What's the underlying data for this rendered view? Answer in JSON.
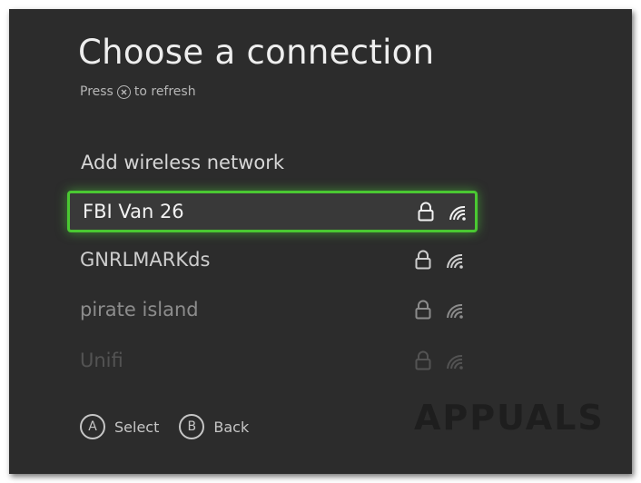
{
  "screen": {
    "title": "Choose a connection",
    "hint_prefix": "Press",
    "hint_button": "X",
    "hint_suffix": "to refresh",
    "add_network_label": "Add wireless network"
  },
  "networks": [
    {
      "name": "FBI Van 26",
      "secured": true,
      "selected": true,
      "opacity": 1.0
    },
    {
      "name": "GNRLMARKds",
      "secured": true,
      "selected": false,
      "opacity": 0.92
    },
    {
      "name": "pirate island",
      "secured": true,
      "selected": false,
      "opacity": 0.55
    },
    {
      "name": "Unifi",
      "secured": true,
      "selected": false,
      "opacity": 0.22
    }
  ],
  "legend": {
    "a_button": "A",
    "a_label": "Select",
    "b_button": "B",
    "b_label": "Back"
  },
  "watermark": {
    "text": "APPUALS"
  },
  "colors": {
    "background": "#2c2c2c",
    "selection_accent": "#4ac832",
    "text_primary": "#eeeeee"
  }
}
